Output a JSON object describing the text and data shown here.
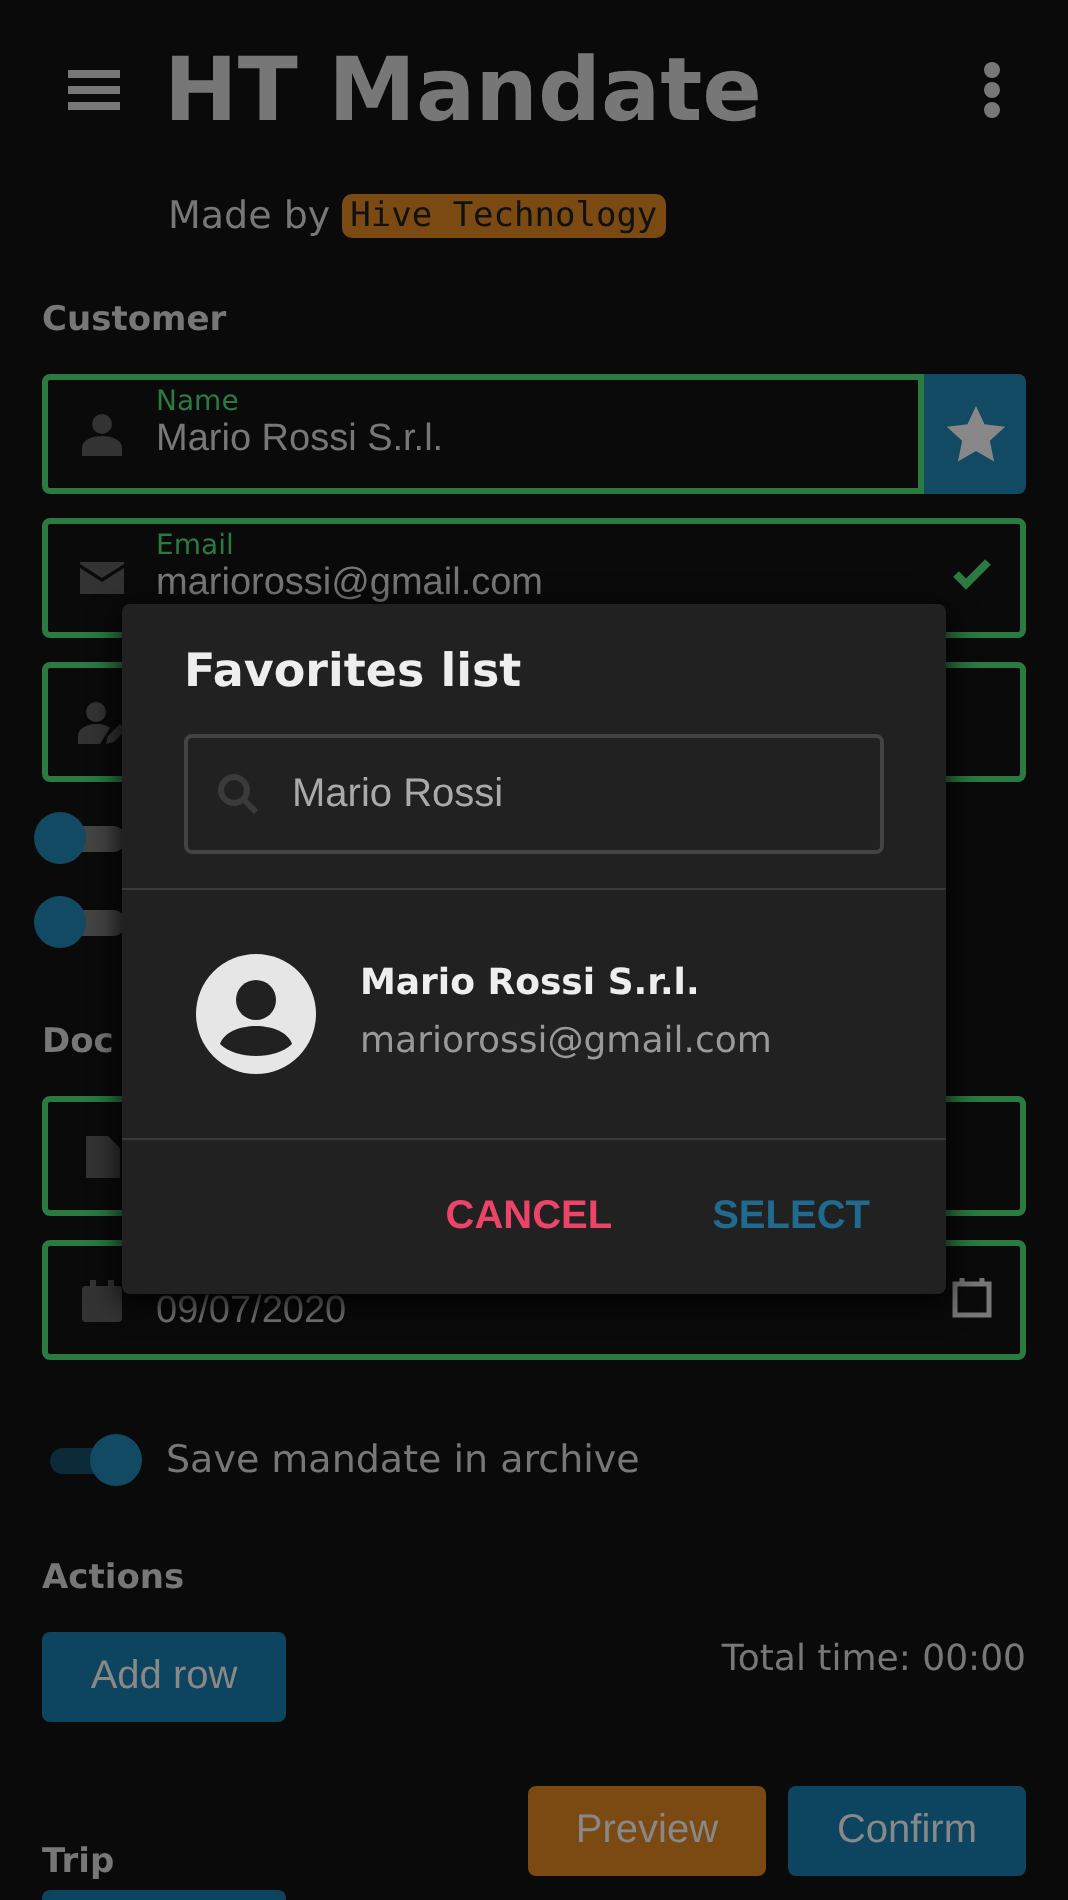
{
  "app_bar": {
    "title": "HT Mandate",
    "made_by": "Made by",
    "brand": "Hive Technology"
  },
  "customer": {
    "heading": "Customer",
    "fields": [
      {
        "kind": "name",
        "label": "Name",
        "value": "Mario Rossi S.r.l.",
        "favorite_button": true
      },
      {
        "kind": "email",
        "label": "Email",
        "value": "mariorossi@gmail.com",
        "valid": true
      },
      {
        "kind": "contact"
      }
    ],
    "toggles": [
      {
        "checked": false
      },
      {
        "checked": false
      }
    ]
  },
  "document": {
    "heading": "Doc",
    "fields": [
      {
        "kind": "document"
      },
      {
        "kind": "date",
        "value": "09/07/2020"
      }
    ]
  },
  "archive_toggle": {
    "label": "Save mandate in archive",
    "checked": true
  },
  "actions": {
    "heading": "Actions",
    "add_button": "Add row",
    "total_time": "Total time: 00:00"
  },
  "trip": {
    "heading": "Trip",
    "buttons": [
      {
        "kind": "preview",
        "label": "Preview"
      },
      {
        "kind": "confirm",
        "label": "Confirm"
      }
    ]
  },
  "dialog": {
    "title": "Favorites list",
    "search": {
      "value": "Mario Rossi"
    },
    "results": [
      {
        "name": "Mario Rossi S.r.l.",
        "email": "mariorossi@gmail.com"
      }
    ],
    "buttons": [
      {
        "kind": "cancel",
        "label": "CANCEL"
      },
      {
        "kind": "select",
        "label": "SELECT"
      }
    ]
  }
}
